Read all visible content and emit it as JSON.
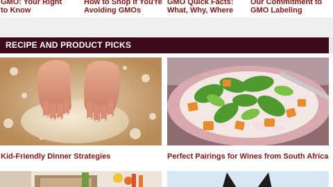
{
  "top_links": [
    {
      "line1": "GMO: Your Right",
      "line2": "to Know"
    },
    {
      "line1": "How to Shop If You're",
      "line2": "Avoiding GMOs"
    },
    {
      "line1": "GMO Quick Facts:",
      "line2": "What, Why, Where"
    },
    {
      "line1": "Our Commitment to",
      "line2": "GMO Labeling"
    }
  ],
  "section": {
    "title": "RECIPE AND PRODUCT PICKS"
  },
  "tiles": [
    {
      "caption": "Kid-Friendly Dinner Strategies"
    },
    {
      "caption": "Perfect Pairings for Wines from South Africa"
    }
  ],
  "colors": {
    "link": "#8a1414",
    "banner": "#3d0a1c"
  }
}
